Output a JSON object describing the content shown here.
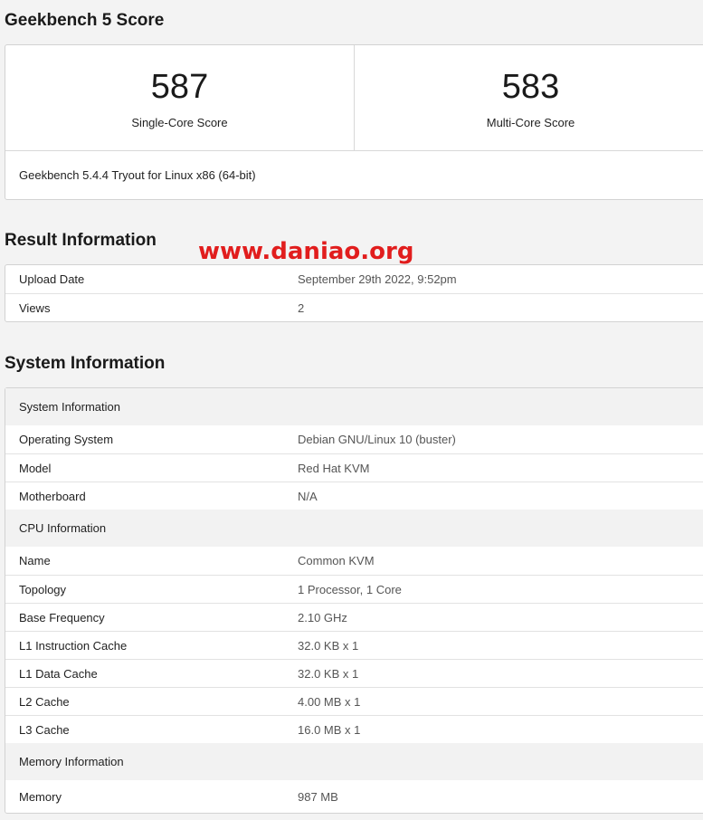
{
  "score_section": {
    "title": "Geekbench 5 Score",
    "single_core": {
      "value": "587",
      "label": "Single-Core Score"
    },
    "multi_core": {
      "value": "583",
      "label": "Multi-Core Score"
    },
    "footer": "Geekbench 5.4.4 Tryout for Linux x86 (64-bit)"
  },
  "watermark": "www.daniao.org",
  "result_section": {
    "title": "Result Information",
    "rows": [
      {
        "key": "Upload Date",
        "value": "September 29th 2022, 9:52pm"
      },
      {
        "key": "Views",
        "value": "2"
      }
    ]
  },
  "system_section": {
    "title": "System Information",
    "groups": [
      {
        "header": "System Information",
        "rows": [
          {
            "key": "Operating System",
            "value": "Debian GNU/Linux 10 (buster)"
          },
          {
            "key": "Model",
            "value": "Red Hat KVM"
          },
          {
            "key": "Motherboard",
            "value": "N/A"
          }
        ]
      },
      {
        "header": "CPU Information",
        "rows": [
          {
            "key": "Name",
            "value": "Common KVM"
          },
          {
            "key": "Topology",
            "value": "1 Processor, 1 Core"
          },
          {
            "key": "Base Frequency",
            "value": "2.10 GHz"
          },
          {
            "key": "L1 Instruction Cache",
            "value": "32.0 KB x 1"
          },
          {
            "key": "L1 Data Cache",
            "value": "32.0 KB x 1"
          },
          {
            "key": "L2 Cache",
            "value": "4.00 MB x 1"
          },
          {
            "key": "L3 Cache",
            "value": "16.0 MB x 1"
          }
        ]
      },
      {
        "header": "Memory Information",
        "rows": [
          {
            "key": "Memory",
            "value": "987 MB"
          }
        ]
      }
    ]
  },
  "colors": {
    "background": "#f3f3f3",
    "card": "#ffffff",
    "group_header": "#f2f2f2",
    "watermark": "#e11d1d"
  }
}
